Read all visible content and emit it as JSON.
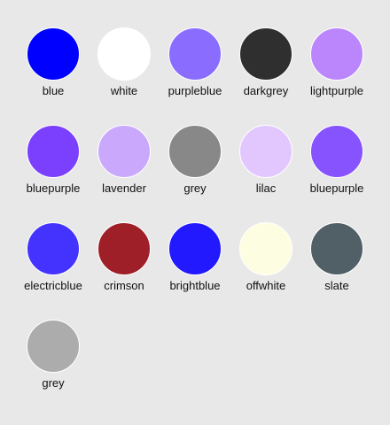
{
  "swatches": [
    {
      "label": "blue",
      "color": "#0000ff"
    },
    {
      "label": "white",
      "color": "#ffffff"
    },
    {
      "label": "purpleblue",
      "color": "#8a6cff"
    },
    {
      "label": "darkgrey",
      "color": "#2f2f2f"
    },
    {
      "label": "lightpurple",
      "color": "#bb86fb"
    },
    {
      "label": "bluepurple",
      "color": "#7b3ffe"
    },
    {
      "label": "lavender",
      "color": "#caa9fd"
    },
    {
      "label": "grey",
      "color": "#888888"
    },
    {
      "label": "lilac",
      "color": "#e2c7ff"
    },
    {
      "label": "bluepurple",
      "color": "#8753ff"
    },
    {
      "label": "electricblue",
      "color": "#4433ff"
    },
    {
      "label": "crimson",
      "color": "#9e1f27"
    },
    {
      "label": "brightblue",
      "color": "#2219ff"
    },
    {
      "label": "offwhite",
      "color": "#fdfde1"
    },
    {
      "label": "slate",
      "color": "#516066"
    },
    {
      "label": "grey",
      "color": "#acacac"
    }
  ]
}
